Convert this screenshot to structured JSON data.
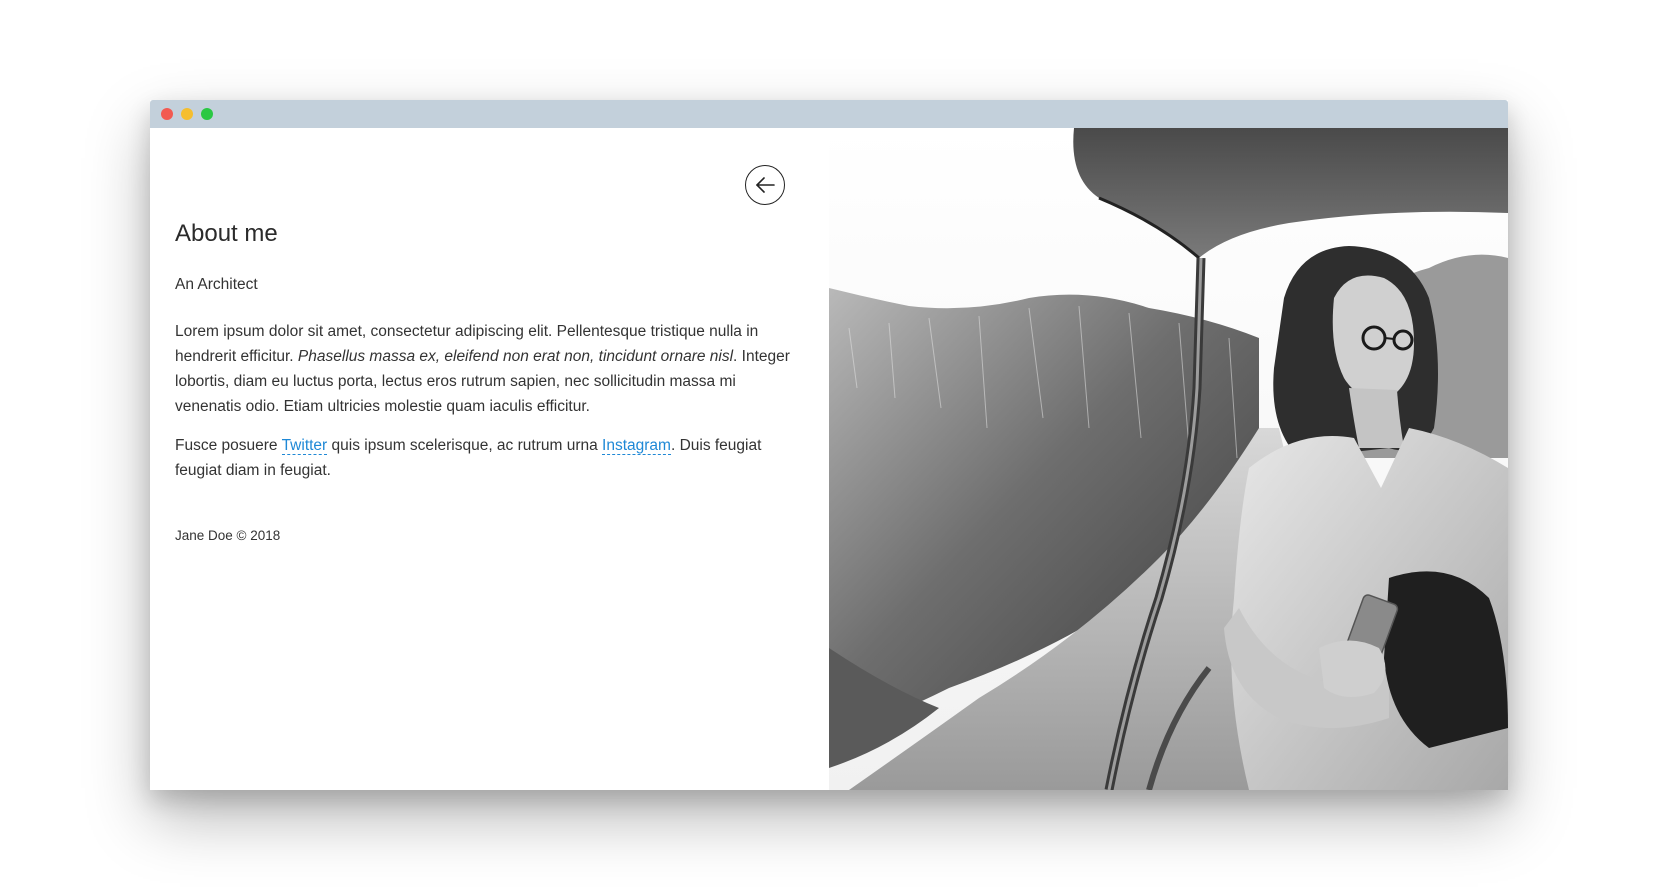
{
  "window": {
    "controls": [
      "close",
      "minimize",
      "maximize"
    ]
  },
  "nav": {
    "back_icon": "arrow-left-icon"
  },
  "about": {
    "title": "About me",
    "subtitle": "An Architect",
    "paragraph1": {
      "text_before": "Lorem ipsum dolor sit amet, consectetur adipiscing elit. Pellentesque tristique nulla in hendrerit efficitur. ",
      "emphasis": "Phasellus massa ex, eleifend non erat non, tincidunt ornare nisl",
      "text_after": ". Integer lobortis, diam eu luctus porta, lectus eros rutrum sapien, nec sollicitudin massa mi venenatis odio. Etiam ultricies molestie quam iaculis efficitur."
    },
    "paragraph2": {
      "text_before": "Fusce posuere ",
      "link1": "Twitter",
      "text_middle": " quis ipsum scelerisque, ac rutrum urna ",
      "link2": "Instagram",
      "text_after": ". Duis feugiat feugiat diam in feugiat."
    },
    "footer": "Jane Doe © 2018"
  },
  "colors": {
    "titlebar": "#c3d0db",
    "close": "#f25a51",
    "minimize": "#f5be2e",
    "maximize": "#2ac843",
    "link": "#1e88d6",
    "text": "#333333"
  }
}
